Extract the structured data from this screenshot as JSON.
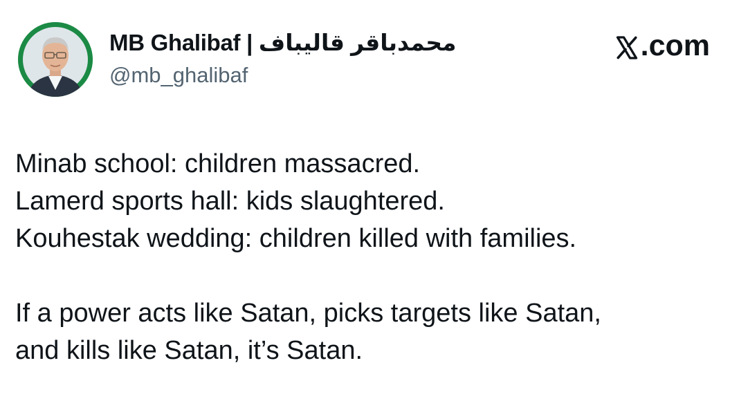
{
  "tweet": {
    "author": {
      "display_name": "MB Ghalibaf | محمدباقر قالیباف",
      "handle": "@mb_ghalibaf",
      "avatar_icon": "profile-photo"
    },
    "brand": {
      "icon": "x-logo-icon",
      "label": ".com"
    },
    "paragraphs": [
      {
        "lines": [
          "Minab school: children massacred.",
          "Lamerd sports hall: kids slaughtered.",
          "Kouhestak wedding: children killed with families."
        ]
      },
      {
        "lines": [
          "If a power acts like Satan, picks targets like Satan,",
          "and kills like Satan, it’s Satan."
        ]
      }
    ]
  },
  "colors": {
    "text": "#0f1419",
    "secondary": "#536471",
    "avatar_ring": "#1b8a45"
  }
}
